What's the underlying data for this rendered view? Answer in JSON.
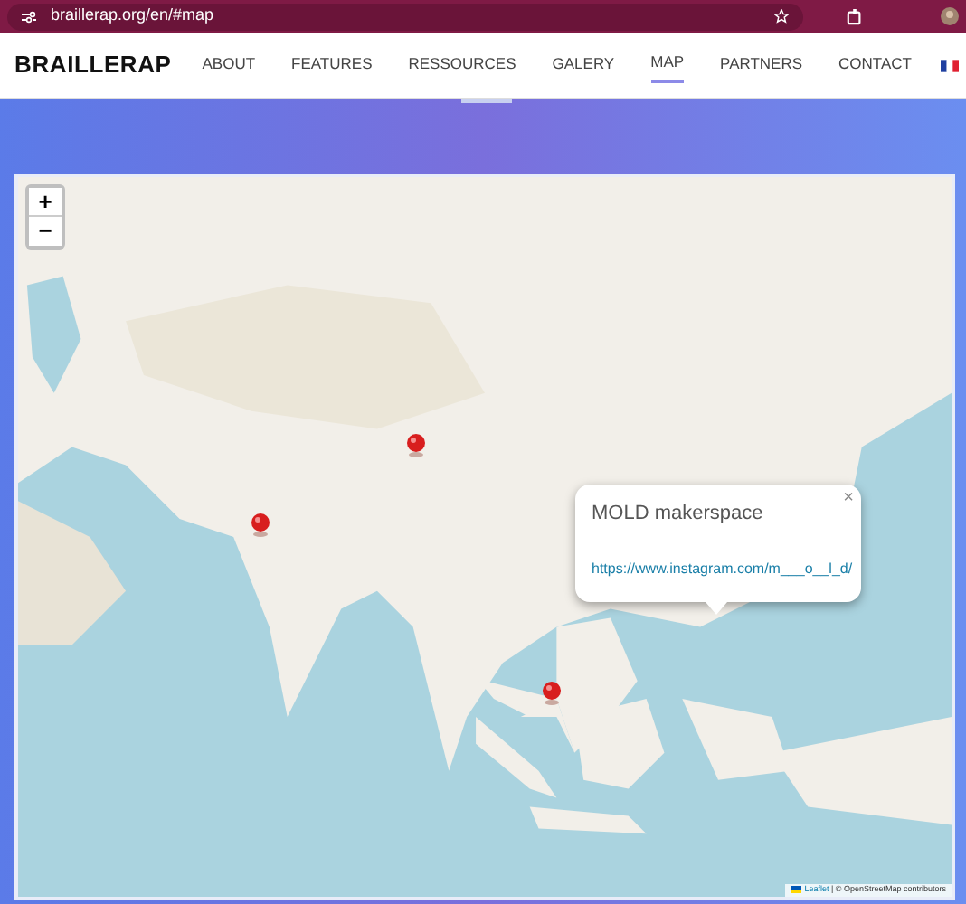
{
  "browser": {
    "url": "braillerap.org/en/#map"
  },
  "brand": "BRAILLERAP",
  "nav": [
    {
      "label": "ABOUT",
      "selected": false
    },
    {
      "label": "FEATURES",
      "selected": false
    },
    {
      "label": "RESSOURCES",
      "selected": false
    },
    {
      "label": "GALERY",
      "selected": false
    },
    {
      "label": "MAP",
      "selected": true
    },
    {
      "label": "PARTNERS",
      "selected": false
    },
    {
      "label": "CONTACT",
      "selected": false
    }
  ],
  "map": {
    "zoom_in": "+",
    "zoom_out": "−",
    "popup": {
      "close": "×",
      "title": "MOLD makerspace",
      "link": "https://www.instagram.com/m___o__l_d/"
    },
    "attribution": {
      "link": "Leaflet",
      "text": "| © OpenStreetMap contributors"
    }
  }
}
